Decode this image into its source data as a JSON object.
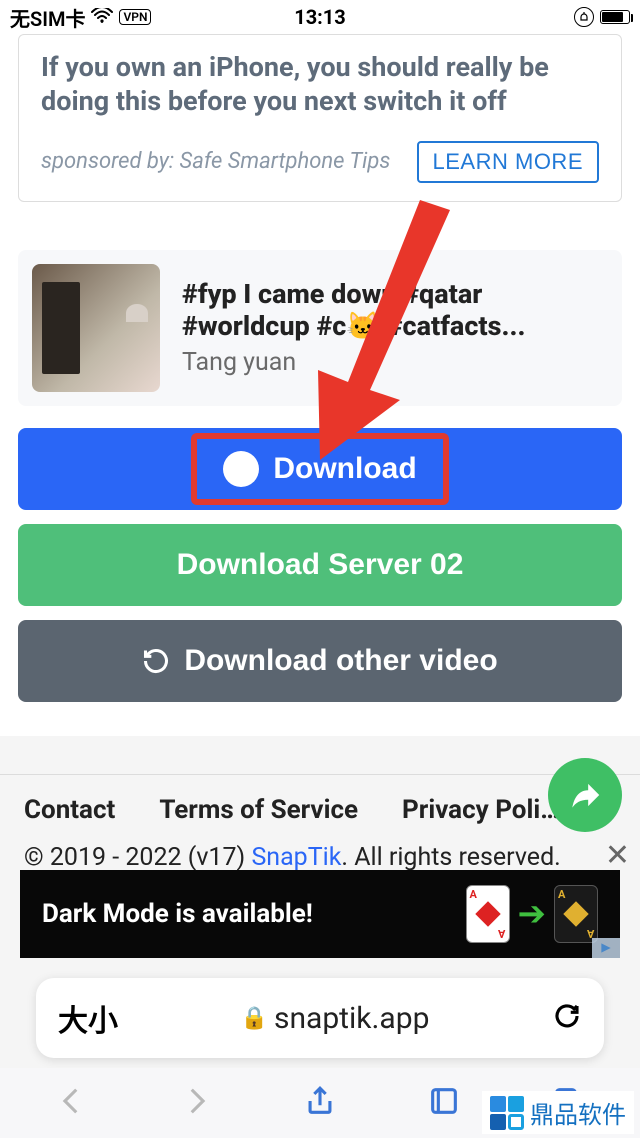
{
  "status": {
    "carrier": "无SIM卡",
    "vpn": "VPN",
    "time": "13:13"
  },
  "ad_card": {
    "headline": "If you own an iPhone, you should really be doing this before you next switch it off",
    "sponsor": "sponsored by: Safe Smartphone Tips",
    "cta": "LEARN MORE"
  },
  "video": {
    "title": "#fyp I came down #qatar #worldcup #c🐱 #catfacts...",
    "author": "Tang yuan"
  },
  "buttons": {
    "download": "Download",
    "server02": "Download Server 02",
    "other": "Download other video"
  },
  "footer": {
    "links": {
      "contact": "Contact",
      "terms": "Terms of Service",
      "privacy": "Privacy Poli…"
    },
    "copyright_pre": "© 2019 - 2022 (v17) ",
    "brand": "SnapTik",
    "copyright_post": ". All rights reserved."
  },
  "dark_banner": {
    "text": "Dark Mode is available!"
  },
  "address_bar": {
    "zoom": "大小",
    "url": "snaptik.app"
  },
  "watermark": "鼎品软件"
}
